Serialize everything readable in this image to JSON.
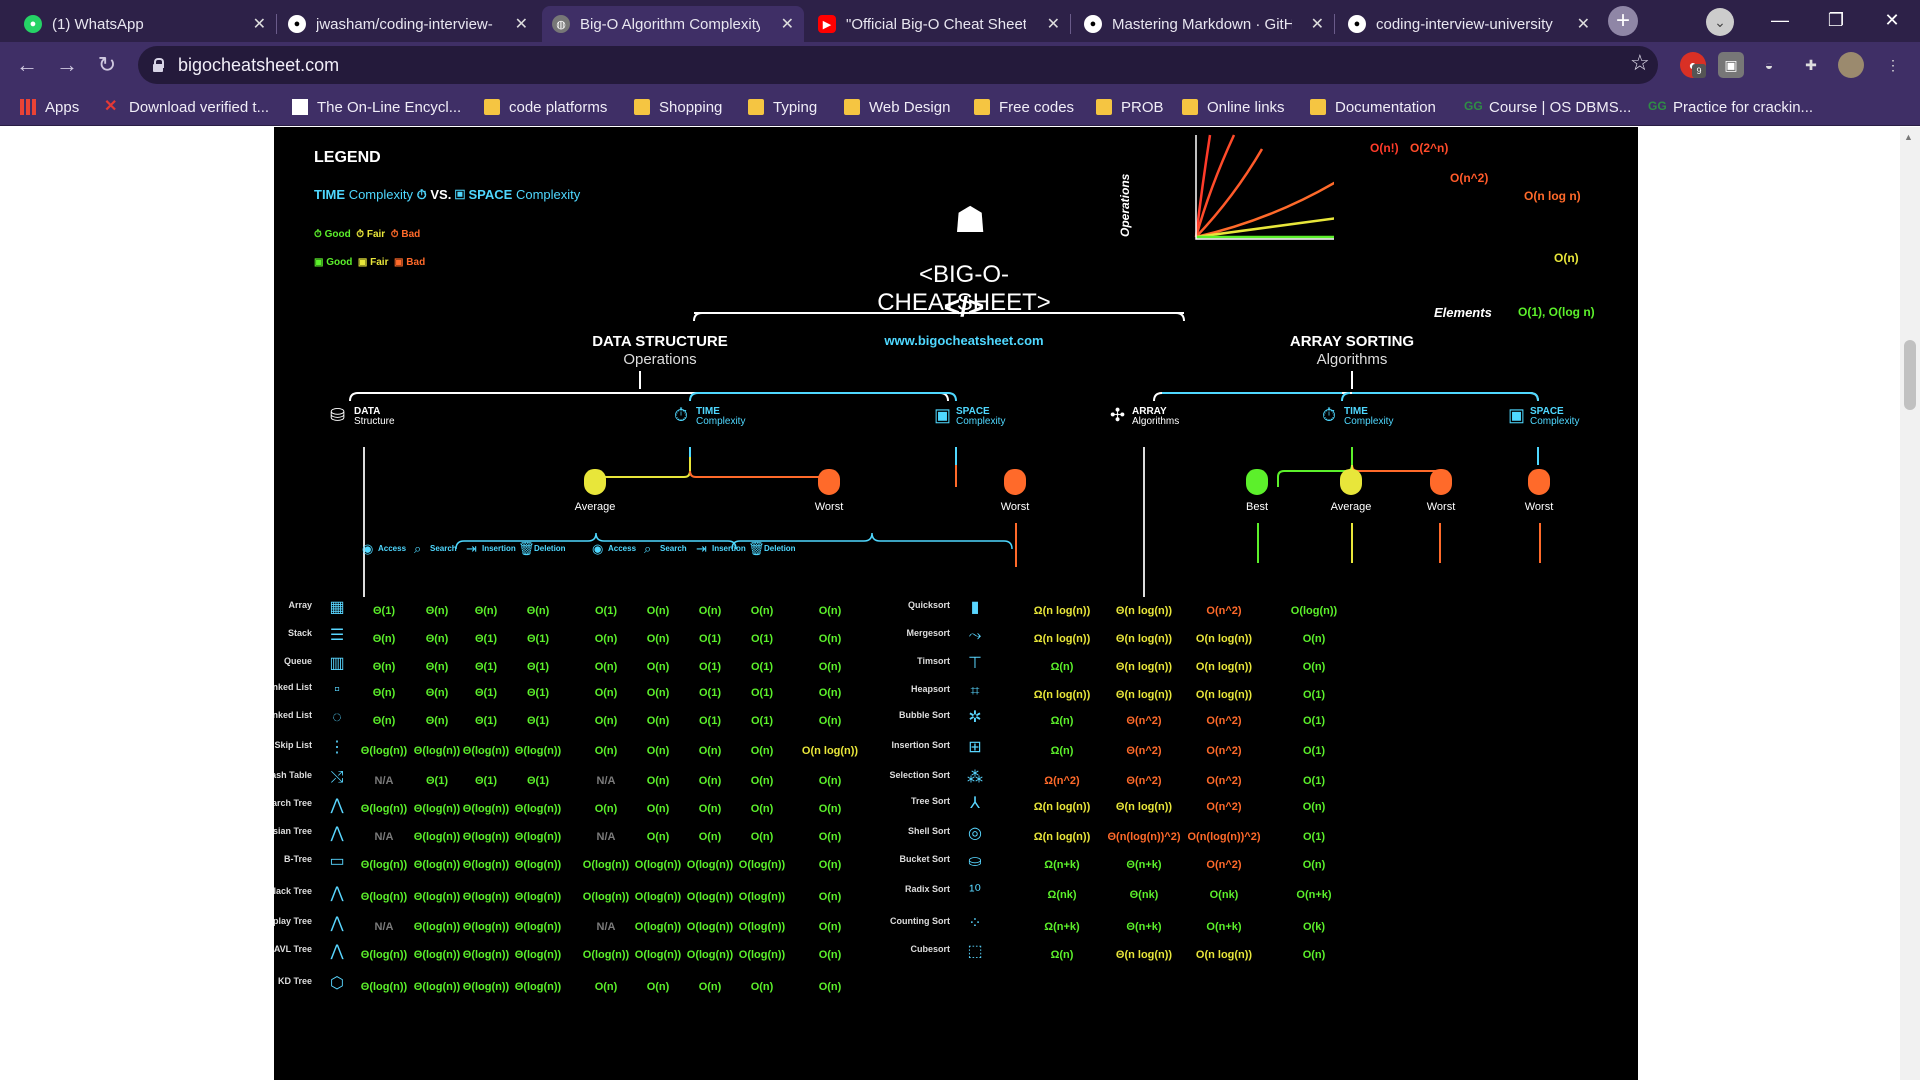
{
  "tabs": [
    {
      "title": "(1) WhatsApp",
      "active": false,
      "icon": "whatsapp-icon"
    },
    {
      "title": "jwasham/coding-interview-",
      "active": false,
      "icon": "github-icon"
    },
    {
      "title": "Big-O Algorithm Complexity",
      "active": true,
      "icon": "globe-icon"
    },
    {
      "title": "\"Official Big-O Cheat Sheet",
      "active": false,
      "icon": "youtube-icon"
    },
    {
      "title": "Mastering Markdown · GitH",
      "active": false,
      "icon": "github-icon"
    },
    {
      "title": "coding-interview-university",
      "active": false,
      "icon": "github-icon"
    }
  ],
  "address": {
    "url": "bigocheatsheet.com"
  },
  "extension_badge": "9",
  "bookmarks": [
    {
      "label": "Apps",
      "icon": "apps-grid-icon"
    },
    {
      "label": "Download verified t...",
      "icon": "x-logo-icon"
    },
    {
      "label": "The On-Line Encycl...",
      "icon": "oeis-icon"
    },
    {
      "label": "code platforms",
      "icon": "folder-icon"
    },
    {
      "label": "Shopping",
      "icon": "folder-icon"
    },
    {
      "label": "Typing",
      "icon": "folder-icon"
    },
    {
      "label": "Web Design",
      "icon": "folder-icon"
    },
    {
      "label": "Free codes",
      "icon": "folder-icon"
    },
    {
      "label": "PROB",
      "icon": "folder-icon"
    },
    {
      "label": "Online links",
      "icon": "folder-icon"
    },
    {
      "label": "Documentation",
      "icon": "folder-icon"
    },
    {
      "label": "Course | OS DBMS...",
      "icon": "gfg-icon"
    },
    {
      "label": "Practice for crackin...",
      "icon": "gfg-icon"
    }
  ],
  "cheatsheet": {
    "legend": {
      "title": "LEGEND",
      "time": "TIME",
      "complexity": "Complexity",
      "vs": "VS.",
      "space": "SPACE",
      "good": "Good",
      "fair": "Fair",
      "bad": "Bad"
    },
    "logo_text": "<BIG-O-CHEATSHEET>",
    "code_glyph": "</>",
    "website": "www.bigocheatsheet.com",
    "ds_title": "DATA STRUCTURE",
    "ds_subtitle": "Operations",
    "sort_title": "ARRAY SORTING",
    "sort_subtitle": "Algorithms",
    "data_structure_label": [
      "DATA",
      "Structure"
    ],
    "time_complexity_label": [
      "TIME",
      "Complexity"
    ],
    "space_complexity_label": [
      "SPACE",
      "Complexity"
    ],
    "array_algorithms_label": [
      "ARRAY",
      "Algorithms"
    ],
    "cases": {
      "average": "Average",
      "worst": "Worst",
      "best": "Best"
    },
    "ops": [
      "Access",
      "Search",
      "Insertion",
      "Deletion"
    ],
    "graph": {
      "ylabel": "Operations",
      "xlabel": "Elements",
      "curves": [
        "O(n!)",
        "O(2^n)",
        "O(n^2)",
        "O(n log n)",
        "O(n)",
        "O(1), O(log n)"
      ]
    },
    "ds_rows": [
      {
        "name": "Array",
        "avg": [
          "Θ(1)",
          "Θ(n)",
          "Θ(n)",
          "Θ(n)"
        ],
        "worst": [
          "O(1)",
          "O(n)",
          "O(n)",
          "O(n)"
        ],
        "space": "O(n)"
      },
      {
        "name": "Stack",
        "avg": [
          "Θ(n)",
          "Θ(n)",
          "Θ(1)",
          "Θ(1)"
        ],
        "worst": [
          "O(n)",
          "O(n)",
          "O(1)",
          "O(1)"
        ],
        "space": "O(n)"
      },
      {
        "name": "Queue",
        "avg": [
          "Θ(n)",
          "Θ(n)",
          "Θ(1)",
          "Θ(1)"
        ],
        "worst": [
          "O(n)",
          "O(n)",
          "O(1)",
          "O(1)"
        ],
        "space": "O(n)"
      },
      {
        "name": "Singly-Linked List",
        "avg": [
          "Θ(n)",
          "Θ(n)",
          "Θ(1)",
          "Θ(1)"
        ],
        "worst": [
          "O(n)",
          "O(n)",
          "O(1)",
          "O(1)"
        ],
        "space": "O(n)"
      },
      {
        "name": "Doubly-Linked List",
        "avg": [
          "Θ(n)",
          "Θ(n)",
          "Θ(1)",
          "Θ(1)"
        ],
        "worst": [
          "O(n)",
          "O(n)",
          "O(1)",
          "O(1)"
        ],
        "space": "O(n)"
      },
      {
        "name": "Skip List",
        "avg": [
          "Θ(log(n))",
          "Θ(log(n))",
          "Θ(log(n))",
          "Θ(log(n))"
        ],
        "worst": [
          "O(n)",
          "O(n)",
          "O(n)",
          "O(n)"
        ],
        "space": "O(n log(n))"
      },
      {
        "name": "Hash Table",
        "avg": [
          "N/A",
          "Θ(1)",
          "Θ(1)",
          "Θ(1)"
        ],
        "worst": [
          "N/A",
          "O(n)",
          "O(n)",
          "O(n)"
        ],
        "space": "O(n)"
      },
      {
        "name": "Binary Search Tree",
        "avg": [
          "Θ(log(n))",
          "Θ(log(n))",
          "Θ(log(n))",
          "Θ(log(n))"
        ],
        "worst": [
          "O(n)",
          "O(n)",
          "O(n)",
          "O(n)"
        ],
        "space": "O(n)"
      },
      {
        "name": "Cartesian Tree",
        "avg": [
          "N/A",
          "Θ(log(n))",
          "Θ(log(n))",
          "Θ(log(n))"
        ],
        "worst": [
          "N/A",
          "O(n)",
          "O(n)",
          "O(n)"
        ],
        "space": "O(n)"
      },
      {
        "name": "B-Tree",
        "avg": [
          "Θ(log(n))",
          "Θ(log(n))",
          "Θ(log(n))",
          "Θ(log(n))"
        ],
        "worst": [
          "O(log(n))",
          "O(log(n))",
          "O(log(n))",
          "O(log(n))"
        ],
        "space": "O(n)"
      },
      {
        "name": "Red-Black Tree",
        "avg": [
          "Θ(log(n))",
          "Θ(log(n))",
          "Θ(log(n))",
          "Θ(log(n))"
        ],
        "worst": [
          "O(log(n))",
          "O(log(n))",
          "O(log(n))",
          "O(log(n))"
        ],
        "space": "O(n)"
      },
      {
        "name": "Splay Tree",
        "avg": [
          "N/A",
          "Θ(log(n))",
          "Θ(log(n))",
          "Θ(log(n))"
        ],
        "worst": [
          "N/A",
          "O(log(n))",
          "O(log(n))",
          "O(log(n))"
        ],
        "space": "O(n)"
      },
      {
        "name": "AVL Tree",
        "avg": [
          "Θ(log(n))",
          "Θ(log(n))",
          "Θ(log(n))",
          "Θ(log(n))"
        ],
        "worst": [
          "O(log(n))",
          "O(log(n))",
          "O(log(n))",
          "O(log(n))"
        ],
        "space": "O(n)"
      },
      {
        "name": "KD Tree",
        "avg": [
          "Θ(log(n))",
          "Θ(log(n))",
          "Θ(log(n))",
          "Θ(log(n))"
        ],
        "worst": [
          "O(n)",
          "O(n)",
          "O(n)",
          "O(n)"
        ],
        "space": "O(n)"
      }
    ],
    "sort_rows": [
      {
        "name": "Quicksort",
        "best": "Ω(n log(n))",
        "avg": "Θ(n log(n))",
        "worst": "O(n^2)",
        "space": "O(log(n))"
      },
      {
        "name": "Mergesort",
        "best": "Ω(n log(n))",
        "avg": "Θ(n log(n))",
        "worst": "O(n log(n))",
        "space": "O(n)"
      },
      {
        "name": "Timsort",
        "best": "Ω(n)",
        "avg": "Θ(n log(n))",
        "worst": "O(n log(n))",
        "space": "O(n)"
      },
      {
        "name": "Heapsort",
        "best": "Ω(n log(n))",
        "avg": "Θ(n log(n))",
        "worst": "O(n log(n))",
        "space": "O(1)"
      },
      {
        "name": "Bubble Sort",
        "best": "Ω(n)",
        "avg": "Θ(n^2)",
        "worst": "O(n^2)",
        "space": "O(1)"
      },
      {
        "name": "Insertion Sort",
        "best": "Ω(n)",
        "avg": "Θ(n^2)",
        "worst": "O(n^2)",
        "space": "O(1)"
      },
      {
        "name": "Selection Sort",
        "best": "Ω(n^2)",
        "avg": "Θ(n^2)",
        "worst": "O(n^2)",
        "space": "O(1)"
      },
      {
        "name": "Tree Sort",
        "best": "Ω(n log(n))",
        "avg": "Θ(n log(n))",
        "worst": "O(n^2)",
        "space": "O(n)"
      },
      {
        "name": "Shell Sort",
        "best": "Ω(n log(n))",
        "avg": "Θ(n(log(n))^2)",
        "worst": "O(n(log(n))^2)",
        "space": "O(1)"
      },
      {
        "name": "Bucket Sort",
        "best": "Ω(n+k)",
        "avg": "Θ(n+k)",
        "worst": "O(n^2)",
        "space": "O(n)"
      },
      {
        "name": "Radix Sort",
        "best": "Ω(nk)",
        "avg": "Θ(nk)",
        "worst": "O(nk)",
        "space": "O(n+k)"
      },
      {
        "name": "Counting Sort",
        "best": "Ω(n+k)",
        "avg": "Θ(n+k)",
        "worst": "O(n+k)",
        "space": "O(k)"
      },
      {
        "name": "Cubesort",
        "best": "Ω(n)",
        "avg": "Θ(n log(n))",
        "worst": "O(n log(n))",
        "space": "O(n)"
      }
    ],
    "colors": {
      "good": "#5cf02b",
      "fair": "#e8e63a",
      "bad": "#ff6a2a",
      "accent": "#4fd8ff"
    }
  }
}
